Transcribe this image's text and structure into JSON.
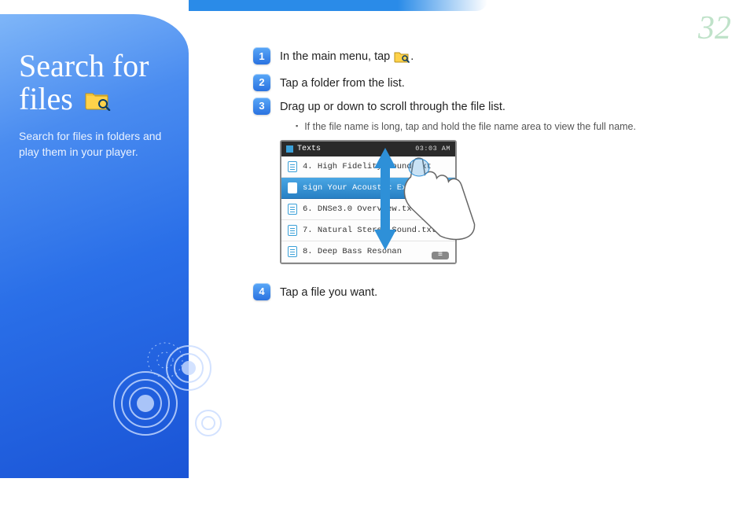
{
  "page_number": "32",
  "sidebar": {
    "title_line1": "Search for",
    "title_line2": "files",
    "subtitle": "Search for files in folders and play them in your player."
  },
  "steps": {
    "s1_pre": "In the main menu, tap ",
    "s1_post": ".",
    "s2": "Tap a folder from the list.",
    "s3": "Drag up or down to scroll through the file list.",
    "s3_note": "If the file name is long, tap and hold the file name area to view the full name.",
    "s4": "Tap a file you want."
  },
  "device": {
    "header_title": "Texts",
    "header_time": "03:03 AM",
    "rows": [
      "4. High Fidelity Sound.txt",
      "sign Your Acoustic Experience",
      "6. DNSe3.0 Overview.txt",
      "7. Natural Stereo Sound.txt",
      "8. Deep Bass Resonan"
    ]
  }
}
